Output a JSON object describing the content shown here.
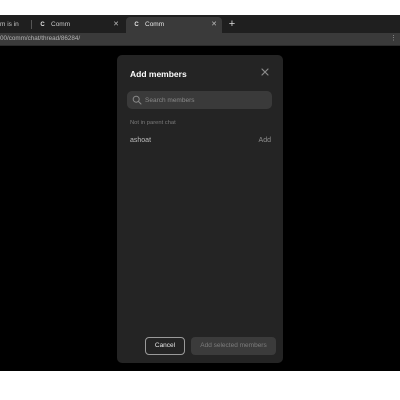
{
  "browser": {
    "tabs": [
      {
        "title": "m is in",
        "favicon": "",
        "active": false
      },
      {
        "title": "Comm",
        "favicon": "C",
        "active": false
      },
      {
        "title": "Comm",
        "favicon": "C",
        "active": true
      }
    ],
    "new_tab_label": "+",
    "url": "00/comm/chat/thread/86284/"
  },
  "modal": {
    "title": "Add members",
    "search": {
      "placeholder": "Search members",
      "value": ""
    },
    "section_label": "Not in parent chat",
    "members": [
      {
        "name": "ashoat",
        "action": "Add"
      }
    ],
    "cancel_label": "Cancel",
    "submit_label": "Add selected members"
  },
  "colors": {
    "background": "#000000",
    "modal": "#242424",
    "search_field": "#3a3a3a",
    "button_disabled": "#3b3b3b"
  }
}
